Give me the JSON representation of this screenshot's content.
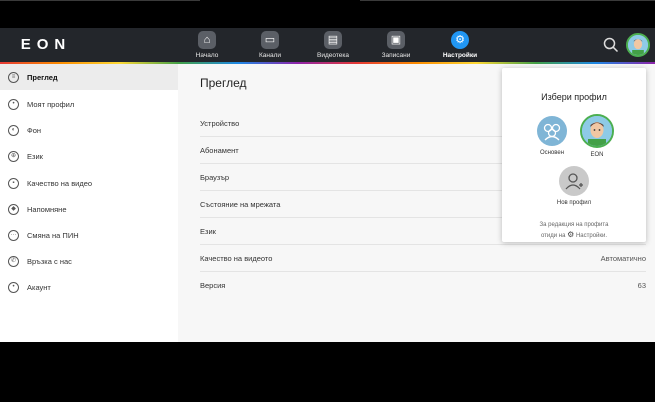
{
  "header": {
    "logo": "EON",
    "nav": [
      {
        "label": "Начало",
        "icon": "home-icon"
      },
      {
        "label": "Канали",
        "icon": "tv-icon"
      },
      {
        "label": "Видеотека",
        "icon": "film-icon"
      },
      {
        "label": "Записани",
        "icon": "folder-icon"
      },
      {
        "label": "Настройки",
        "icon": "gear-icon"
      }
    ],
    "active_nav": "Настройки"
  },
  "sidebar": {
    "items": [
      {
        "label": "Преглед",
        "icon": "overview-icon"
      },
      {
        "label": "Моят профил",
        "icon": "user-icon"
      },
      {
        "label": "Фон",
        "icon": "palette-icon"
      },
      {
        "label": "Език",
        "icon": "globe-icon"
      },
      {
        "label": "Качество на видео",
        "icon": "hd-icon"
      },
      {
        "label": "Напомняне",
        "icon": "compass-icon"
      },
      {
        "label": "Смяна на ПИН",
        "icon": "pin-icon"
      },
      {
        "label": "Връзка с нас",
        "icon": "phone-icon"
      },
      {
        "label": "Акаунт",
        "icon": "account-icon"
      }
    ],
    "active_item": "Преглед"
  },
  "main": {
    "title": "Преглед",
    "rows": [
      {
        "label": "Устройство",
        "value": ""
      },
      {
        "label": "Абонамент",
        "value": ""
      },
      {
        "label": "Браузър",
        "value": ""
      },
      {
        "label": "Състояние на мрежата",
        "value": ""
      },
      {
        "label": "Език",
        "value": ""
      },
      {
        "label": "Качество на видеото",
        "value": "Автоматично"
      },
      {
        "label": "Версия",
        "value": "63"
      }
    ]
  },
  "profile_popup": {
    "title": "Избери профил",
    "profiles": [
      {
        "label": "Основен",
        "icon": "group-icon"
      },
      {
        "label": "EON",
        "icon": "avatar-face"
      }
    ],
    "new_profile": "Нов профил",
    "note_line1": "За редакция на профита",
    "note_line2_prefix": "отиди на",
    "note_line2_link": "Настройки."
  },
  "colors": {
    "accent": "#2196f3",
    "header_bg": "#23262b",
    "profile_ring": "#4caf50"
  }
}
